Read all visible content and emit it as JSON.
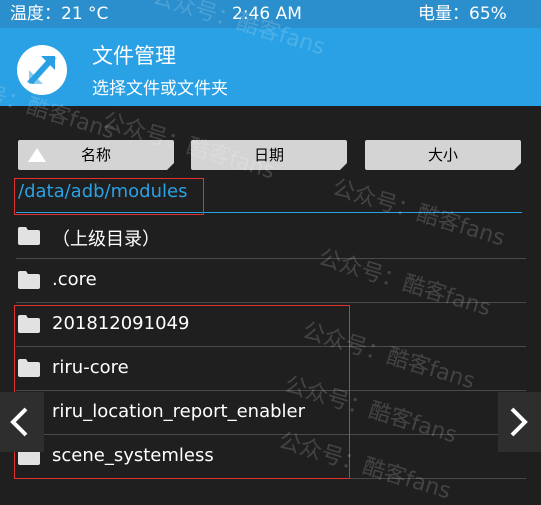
{
  "status_bar": {
    "temperature": "温度：21 °C",
    "time": "2:46 AM",
    "battery": "电量：65%"
  },
  "header": {
    "title": "文件管理",
    "subtitle": "选择文件或文件夹",
    "logo_icon": "twrp-logo-icon"
  },
  "sort": {
    "name_label": "名称",
    "date_label": "日期",
    "size_label": "大小"
  },
  "path": "/data/adb/modules",
  "items": [
    {
      "label": "（上级目录）",
      "icon": "folder-icon"
    },
    {
      "label": ".core",
      "icon": "folder-icon"
    },
    {
      "label": "201812091049",
      "icon": "folder-icon"
    },
    {
      "label": "riru-core",
      "icon": "folder-icon"
    },
    {
      "label": "riru_location_report_enabler",
      "icon": "folder-icon"
    },
    {
      "label": "scene_systemless",
      "icon": "folder-icon"
    }
  ],
  "watermark_text": "公众号：酷客fans",
  "colors": {
    "status_bar": "#2a8fcc",
    "header": "#2aa1e4",
    "accent": "#2aa1e4",
    "background": "#1f1f1f",
    "highlight": "#e03030"
  }
}
